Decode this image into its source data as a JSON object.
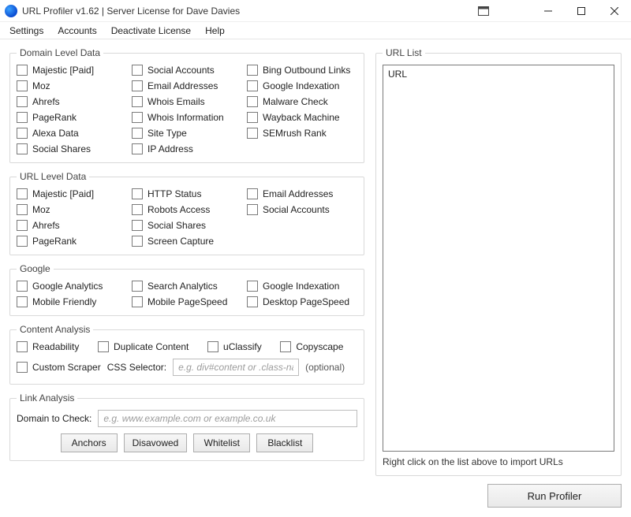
{
  "title": "URL Profiler v1.62 | Server License for Dave Davies",
  "menubar": [
    "Settings",
    "Accounts",
    "Deactivate License",
    "Help"
  ],
  "groups": {
    "domain_level": {
      "legend": "Domain Level Data",
      "items": [
        "Majestic [Paid]",
        "Social Accounts",
        "Bing Outbound Links",
        "Moz",
        "Email Addresses",
        "Google Indexation",
        "Ahrefs",
        "Whois Emails",
        "Malware Check",
        "PageRank",
        "Whois Information",
        "Wayback Machine",
        "Alexa Data",
        "Site Type",
        "SEMrush Rank",
        "Social Shares",
        "IP Address"
      ]
    },
    "url_level": {
      "legend": "URL Level Data",
      "items": [
        "Majestic [Paid]",
        "HTTP Status",
        "Email Addresses",
        "Moz",
        "Robots Access",
        "Social Accounts",
        "Ahrefs",
        "Social Shares",
        "PageRank",
        "Screen Capture"
      ]
    },
    "google": {
      "legend": "Google",
      "items": [
        "Google Analytics",
        "Search Analytics",
        "Google Indexation",
        "Mobile Friendly",
        "Mobile PageSpeed",
        "Desktop PageSpeed"
      ]
    },
    "content": {
      "legend": "Content Analysis",
      "items": [
        "Readability",
        "Duplicate Content",
        "uClassify",
        "Copyscape"
      ],
      "custom_scraper_label": "Custom Scraper",
      "css_selector_label": "CSS Selector:",
      "css_selector_placeholder": "e.g. div#content or .class-na",
      "optional_label": "(optional)"
    },
    "link": {
      "legend": "Link Analysis",
      "domain_label": "Domain to Check:",
      "domain_placeholder": "e.g. www.example.com or example.co.uk",
      "buttons": [
        "Anchors",
        "Disavowed",
        "Whitelist",
        "Blacklist"
      ]
    }
  },
  "url_list": {
    "legend": "URL List",
    "header": "URL",
    "hint": "Right click on the list above to import URLs"
  },
  "run_label": "Run Profiler"
}
